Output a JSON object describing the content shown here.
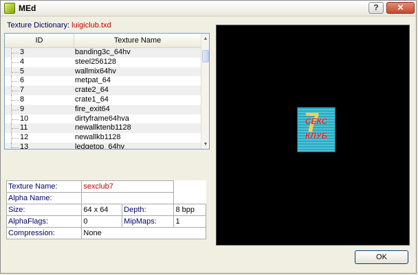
{
  "window": {
    "title": "MEd",
    "help_label": "?",
    "close_label": "✕"
  },
  "dictionary": {
    "label": "Texture Dictionary: ",
    "value": "luigiclub.txd"
  },
  "list": {
    "columns": [
      "ID",
      "Texture Name"
    ],
    "rows": [
      {
        "id": "3",
        "name": "banding3c_64hv"
      },
      {
        "id": "4",
        "name": "steel256128"
      },
      {
        "id": "5",
        "name": "wallmix64hv"
      },
      {
        "id": "6",
        "name": "metpat_64"
      },
      {
        "id": "7",
        "name": "crate2_64"
      },
      {
        "id": "8",
        "name": "crate1_64"
      },
      {
        "id": "9",
        "name": "fire_exit64"
      },
      {
        "id": "10",
        "name": "dirtyframe64hva"
      },
      {
        "id": "11",
        "name": "newallktenb1128"
      },
      {
        "id": "12",
        "name": "newallkb1128"
      },
      {
        "id": "13",
        "name": "ledgetop_64hv"
      }
    ]
  },
  "properties": {
    "texture_name_label": "Texture Name:",
    "texture_name_value": "sexclub7",
    "alpha_name_label": "Alpha Name:",
    "alpha_name_value": "",
    "size_label": "Size:",
    "size_value": "64 x 64",
    "depth_label": "Depth:",
    "depth_value": "8 bpp",
    "alphaflags_label": "AlphaFlags:",
    "alphaflags_value": "0",
    "mipmaps_label": "MipMaps:",
    "mipmaps_value": "1",
    "compression_label": "Compression:",
    "compression_value": "None"
  },
  "preview": {
    "texture_text_line1": "СЕКС",
    "texture_text_line2": "КЛУБ"
  },
  "buttons": {
    "ok_label": "OK"
  }
}
